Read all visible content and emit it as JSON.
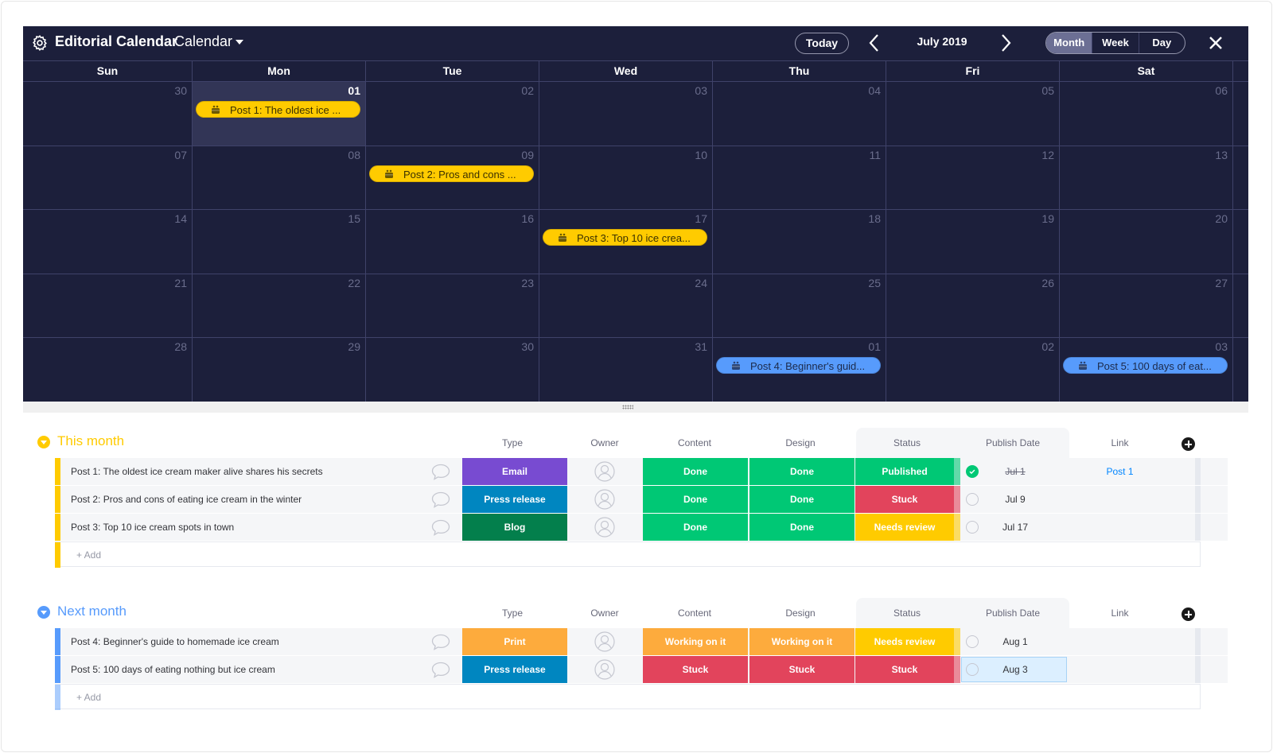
{
  "calendar": {
    "board_title": "Editorial Calendar",
    "view_name": "Calendar",
    "today_label": "Today",
    "month_label": "July 2019",
    "views": [
      "Month",
      "Week",
      "Day"
    ],
    "active_view": "Month",
    "days_of_week": [
      "Sun",
      "Mon",
      "Tue",
      "Wed",
      "Thu",
      "Fri",
      "Sat"
    ],
    "weeks": [
      [
        "30",
        "01",
        "02",
        "03",
        "04",
        "05",
        "06"
      ],
      [
        "07",
        "08",
        "09",
        "10",
        "11",
        "12",
        "13"
      ],
      [
        "14",
        "15",
        "16",
        "17",
        "18",
        "19",
        "20"
      ],
      [
        "21",
        "22",
        "23",
        "24",
        "25",
        "26",
        "27"
      ],
      [
        "28",
        "29",
        "30",
        "31",
        "01",
        "02",
        "03"
      ]
    ],
    "today": "01",
    "events": [
      {
        "label": "Post 1: The oldest ice ...",
        "week": 0,
        "day": 1,
        "color": "yellow"
      },
      {
        "label": "Post 2: Pros and cons ...",
        "week": 1,
        "day": 2,
        "color": "yellow"
      },
      {
        "label": "Post 3: Top 10 ice crea...",
        "week": 2,
        "day": 3,
        "color": "yellow"
      },
      {
        "label": "Post 4: Beginner's guid...",
        "week": 4,
        "day": 4,
        "color": "blue"
      },
      {
        "label": "Post 5: 100 days of eat...",
        "week": 4,
        "day": 6,
        "color": "blue"
      }
    ]
  },
  "columns": {
    "type": "Type",
    "owner": "Owner",
    "content": "Content",
    "design": "Design",
    "status": "Status",
    "publish_date": "Publish Date",
    "link": "Link"
  },
  "colors": {
    "email": "#784bd1",
    "press_release": "#0086c0",
    "blog": "#037f4c",
    "print": "#fdab3d",
    "done": "#00c875",
    "published": "#00c875",
    "stuck": "#e2445c",
    "needs_review": "#ffcb00",
    "working": "#fdab3d",
    "this_month": "#ffcb00",
    "next_month": "#579bfc"
  },
  "groups": [
    {
      "title": "This month",
      "color": "#ffcb00",
      "add_label": "+ Add",
      "items": [
        {
          "name": "Post 1: The oldest ice cream maker alive shares his secrets",
          "type": "Email",
          "type_color": "#784bd1",
          "content": "Done",
          "content_color": "#00c875",
          "design": "Done",
          "design_color": "#00c875",
          "status": "Published",
          "status_color": "#00c875",
          "date": "Jul 1",
          "date_done": true,
          "link": "Post 1"
        },
        {
          "name": "Post 2: Pros and cons of eating ice cream in the winter",
          "type": "Press release",
          "type_color": "#0086c0",
          "content": "Done",
          "content_color": "#00c875",
          "design": "Done",
          "design_color": "#00c875",
          "status": "Stuck",
          "status_color": "#e2445c",
          "date": "Jul 9",
          "date_done": false,
          "link": ""
        },
        {
          "name": "Post 3: Top 10 ice cream spots in town",
          "type": "Blog",
          "type_color": "#037f4c",
          "content": "Done",
          "content_color": "#00c875",
          "design": "Done",
          "design_color": "#00c875",
          "status": "Needs review",
          "status_color": "#ffcb00",
          "date": "Jul 17",
          "date_done": false,
          "link": ""
        }
      ]
    },
    {
      "title": "Next month",
      "color": "#579bfc",
      "add_label": "+ Add",
      "items": [
        {
          "name": "Post 4: Beginner's guide to homemade ice cream",
          "type": "Print",
          "type_color": "#fdab3d",
          "content": "Working on it",
          "content_color": "#fdab3d",
          "design": "Working on it",
          "design_color": "#fdab3d",
          "status": "Needs review",
          "status_color": "#ffcb00",
          "date": "Aug 1",
          "date_done": false,
          "link": ""
        },
        {
          "name": "Post 5: 100 days of eating nothing but ice cream",
          "type": "Press release",
          "type_color": "#0086c0",
          "content": "Stuck",
          "content_color": "#e2445c",
          "design": "Stuck",
          "design_color": "#e2445c",
          "status": "Stuck",
          "status_color": "#e2445c",
          "date": "Aug 3",
          "date_done": false,
          "date_selected": true,
          "link": ""
        }
      ]
    }
  ]
}
